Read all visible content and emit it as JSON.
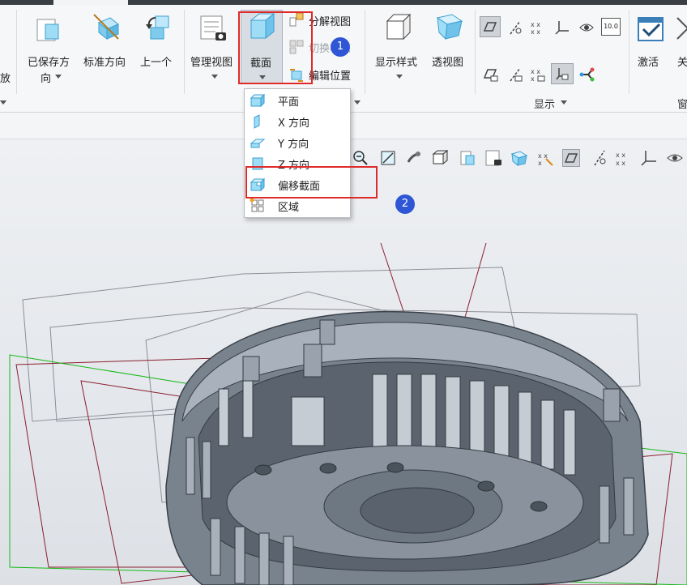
{
  "ribbon": {
    "left_label": "放",
    "saved_direction": {
      "line1": "已保存方",
      "line2": "向"
    },
    "standard_direction": "标准方向",
    "previous": "上一个",
    "manage_views": "管理视图",
    "section": "截面",
    "exploded_view": "分解视图",
    "toggle_status": "切换状态",
    "edit_position": "编辑位置",
    "display_style": "显示样式",
    "perspective": "透视图",
    "activate": "激活",
    "close_partial": "关",
    "display_group": "显示",
    "window_partial": "窗",
    "view_badge_text": "10.0"
  },
  "section_menu": {
    "items": [
      {
        "label": "平面"
      },
      {
        "label": "X 方向"
      },
      {
        "label": "Y 方向"
      },
      {
        "label": "Z 方向"
      },
      {
        "label": "偏移截面"
      },
      {
        "label": "区域"
      }
    ]
  },
  "annotations": {
    "step1": "1",
    "step2": "2",
    "highlight_color": "#e02a2a",
    "badge_color": "#2f56d4"
  },
  "colors": {
    "model": "#6b7682",
    "datum_planes": "#8a1f2f",
    "datum_green": "#17b817",
    "icon_cyan": "#44b8e8"
  }
}
